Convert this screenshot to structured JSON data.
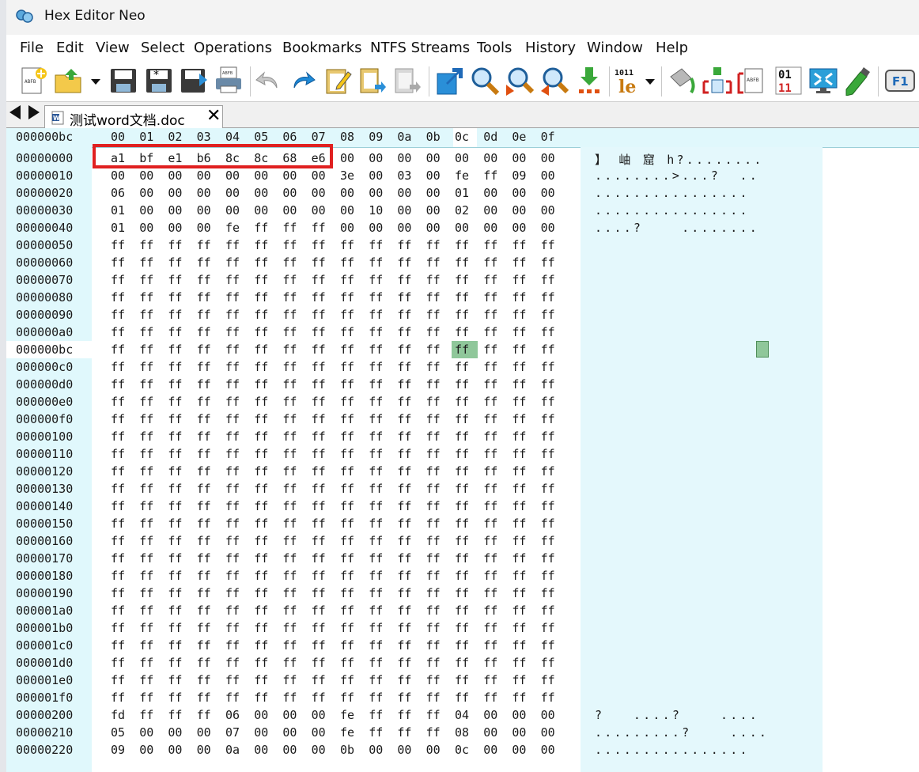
{
  "window": {
    "title": "Hex Editor Neo"
  },
  "menu": [
    "File",
    "Edit",
    "View",
    "Select",
    "Operations",
    "Bookmarks",
    "NTFS Streams",
    "Tools",
    "History",
    "Window",
    "Help"
  ],
  "toolbar_icons": [
    "new-file-icon",
    "open-file-icon",
    "dropdown-arrow-icon",
    "save-icon",
    "save-modified-icon",
    "save-all-icon",
    "print-icon",
    "undo-icon",
    "redo-icon",
    "paste-icon",
    "copy-icon",
    "cut-icon",
    "export-icon",
    "find-icon",
    "find-next-icon",
    "find-prev-icon",
    "goto-icon",
    "pattern-icon",
    "hex-format-icon",
    "fill-icon",
    "compare-icon",
    "insert-icon",
    "binary-icon",
    "fullscreen-icon",
    "highlighter-icon",
    "help-icon"
  ],
  "tab": {
    "label": "测试word文档.doc",
    "close": "✕"
  },
  "hex": {
    "current_offset": "000000bc",
    "column_headers": [
      "00",
      "01",
      "02",
      "03",
      "04",
      "05",
      "06",
      "07",
      "08",
      "09",
      "0a",
      "0b",
      "0c",
      "0d",
      "0e",
      "0f"
    ],
    "rows": [
      {
        "offset": "00000000",
        "bytes": [
          "a1",
          "bf",
          "e1",
          "b6",
          "8c",
          "8c",
          "68",
          "e6",
          "00",
          "00",
          "00",
          "00",
          "00",
          "00",
          "00",
          "00"
        ],
        "ascii": "】 岫 窟 h?........"
      },
      {
        "offset": "00000010",
        "bytes": [
          "00",
          "00",
          "00",
          "00",
          "00",
          "00",
          "00",
          "00",
          "3e",
          "00",
          "03",
          "00",
          "fe",
          "ff",
          "09",
          "00"
        ],
        "ascii": "........>...?  .."
      },
      {
        "offset": "00000020",
        "bytes": [
          "06",
          "00",
          "00",
          "00",
          "00",
          "00",
          "00",
          "00",
          "00",
          "00",
          "00",
          "00",
          "01",
          "00",
          "00",
          "00"
        ],
        "ascii": "................"
      },
      {
        "offset": "00000030",
        "bytes": [
          "01",
          "00",
          "00",
          "00",
          "00",
          "00",
          "00",
          "00",
          "00",
          "10",
          "00",
          "00",
          "02",
          "00",
          "00",
          "00"
        ],
        "ascii": "................"
      },
      {
        "offset": "00000040",
        "bytes": [
          "01",
          "00",
          "00",
          "00",
          "fe",
          "ff",
          "ff",
          "ff",
          "00",
          "00",
          "00",
          "00",
          "00",
          "00",
          "00",
          "00"
        ],
        "ascii": "....?    ........"
      },
      {
        "offset": "00000050",
        "bytes": [
          "ff",
          "ff",
          "ff",
          "ff",
          "ff",
          "ff",
          "ff",
          "ff",
          "ff",
          "ff",
          "ff",
          "ff",
          "ff",
          "ff",
          "ff",
          "ff"
        ],
        "ascii": ""
      },
      {
        "offset": "00000060",
        "bytes": [
          "ff",
          "ff",
          "ff",
          "ff",
          "ff",
          "ff",
          "ff",
          "ff",
          "ff",
          "ff",
          "ff",
          "ff",
          "ff",
          "ff",
          "ff",
          "ff"
        ],
        "ascii": ""
      },
      {
        "offset": "00000070",
        "bytes": [
          "ff",
          "ff",
          "ff",
          "ff",
          "ff",
          "ff",
          "ff",
          "ff",
          "ff",
          "ff",
          "ff",
          "ff",
          "ff",
          "ff",
          "ff",
          "ff"
        ],
        "ascii": ""
      },
      {
        "offset": "00000080",
        "bytes": [
          "ff",
          "ff",
          "ff",
          "ff",
          "ff",
          "ff",
          "ff",
          "ff",
          "ff",
          "ff",
          "ff",
          "ff",
          "ff",
          "ff",
          "ff",
          "ff"
        ],
        "ascii": ""
      },
      {
        "offset": "00000090",
        "bytes": [
          "ff",
          "ff",
          "ff",
          "ff",
          "ff",
          "ff",
          "ff",
          "ff",
          "ff",
          "ff",
          "ff",
          "ff",
          "ff",
          "ff",
          "ff",
          "ff"
        ],
        "ascii": ""
      },
      {
        "offset": "000000a0",
        "bytes": [
          "ff",
          "ff",
          "ff",
          "ff",
          "ff",
          "ff",
          "ff",
          "ff",
          "ff",
          "ff",
          "ff",
          "ff",
          "ff",
          "ff",
          "ff",
          "ff"
        ],
        "ascii": ""
      },
      {
        "offset": "000000bc",
        "bytes": [
          "ff",
          "ff",
          "ff",
          "ff",
          "ff",
          "ff",
          "ff",
          "ff",
          "ff",
          "ff",
          "ff",
          "ff",
          "ff",
          "ff",
          "ff",
          "ff"
        ],
        "ascii": ""
      },
      {
        "offset": "000000c0",
        "bytes": [
          "ff",
          "ff",
          "ff",
          "ff",
          "ff",
          "ff",
          "ff",
          "ff",
          "ff",
          "ff",
          "ff",
          "ff",
          "ff",
          "ff",
          "ff",
          "ff"
        ],
        "ascii": ""
      },
      {
        "offset": "000000d0",
        "bytes": [
          "ff",
          "ff",
          "ff",
          "ff",
          "ff",
          "ff",
          "ff",
          "ff",
          "ff",
          "ff",
          "ff",
          "ff",
          "ff",
          "ff",
          "ff",
          "ff"
        ],
        "ascii": ""
      },
      {
        "offset": "000000e0",
        "bytes": [
          "ff",
          "ff",
          "ff",
          "ff",
          "ff",
          "ff",
          "ff",
          "ff",
          "ff",
          "ff",
          "ff",
          "ff",
          "ff",
          "ff",
          "ff",
          "ff"
        ],
        "ascii": ""
      },
      {
        "offset": "000000f0",
        "bytes": [
          "ff",
          "ff",
          "ff",
          "ff",
          "ff",
          "ff",
          "ff",
          "ff",
          "ff",
          "ff",
          "ff",
          "ff",
          "ff",
          "ff",
          "ff",
          "ff"
        ],
        "ascii": ""
      },
      {
        "offset": "00000100",
        "bytes": [
          "ff",
          "ff",
          "ff",
          "ff",
          "ff",
          "ff",
          "ff",
          "ff",
          "ff",
          "ff",
          "ff",
          "ff",
          "ff",
          "ff",
          "ff",
          "ff"
        ],
        "ascii": ""
      },
      {
        "offset": "00000110",
        "bytes": [
          "ff",
          "ff",
          "ff",
          "ff",
          "ff",
          "ff",
          "ff",
          "ff",
          "ff",
          "ff",
          "ff",
          "ff",
          "ff",
          "ff",
          "ff",
          "ff"
        ],
        "ascii": ""
      },
      {
        "offset": "00000120",
        "bytes": [
          "ff",
          "ff",
          "ff",
          "ff",
          "ff",
          "ff",
          "ff",
          "ff",
          "ff",
          "ff",
          "ff",
          "ff",
          "ff",
          "ff",
          "ff",
          "ff"
        ],
        "ascii": ""
      },
      {
        "offset": "00000130",
        "bytes": [
          "ff",
          "ff",
          "ff",
          "ff",
          "ff",
          "ff",
          "ff",
          "ff",
          "ff",
          "ff",
          "ff",
          "ff",
          "ff",
          "ff",
          "ff",
          "ff"
        ],
        "ascii": ""
      },
      {
        "offset": "00000140",
        "bytes": [
          "ff",
          "ff",
          "ff",
          "ff",
          "ff",
          "ff",
          "ff",
          "ff",
          "ff",
          "ff",
          "ff",
          "ff",
          "ff",
          "ff",
          "ff",
          "ff"
        ],
        "ascii": ""
      },
      {
        "offset": "00000150",
        "bytes": [
          "ff",
          "ff",
          "ff",
          "ff",
          "ff",
          "ff",
          "ff",
          "ff",
          "ff",
          "ff",
          "ff",
          "ff",
          "ff",
          "ff",
          "ff",
          "ff"
        ],
        "ascii": ""
      },
      {
        "offset": "00000160",
        "bytes": [
          "ff",
          "ff",
          "ff",
          "ff",
          "ff",
          "ff",
          "ff",
          "ff",
          "ff",
          "ff",
          "ff",
          "ff",
          "ff",
          "ff",
          "ff",
          "ff"
        ],
        "ascii": ""
      },
      {
        "offset": "00000170",
        "bytes": [
          "ff",
          "ff",
          "ff",
          "ff",
          "ff",
          "ff",
          "ff",
          "ff",
          "ff",
          "ff",
          "ff",
          "ff",
          "ff",
          "ff",
          "ff",
          "ff"
        ],
        "ascii": ""
      },
      {
        "offset": "00000180",
        "bytes": [
          "ff",
          "ff",
          "ff",
          "ff",
          "ff",
          "ff",
          "ff",
          "ff",
          "ff",
          "ff",
          "ff",
          "ff",
          "ff",
          "ff",
          "ff",
          "ff"
        ],
        "ascii": ""
      },
      {
        "offset": "00000190",
        "bytes": [
          "ff",
          "ff",
          "ff",
          "ff",
          "ff",
          "ff",
          "ff",
          "ff",
          "ff",
          "ff",
          "ff",
          "ff",
          "ff",
          "ff",
          "ff",
          "ff"
        ],
        "ascii": ""
      },
      {
        "offset": "000001a0",
        "bytes": [
          "ff",
          "ff",
          "ff",
          "ff",
          "ff",
          "ff",
          "ff",
          "ff",
          "ff",
          "ff",
          "ff",
          "ff",
          "ff",
          "ff",
          "ff",
          "ff"
        ],
        "ascii": ""
      },
      {
        "offset": "000001b0",
        "bytes": [
          "ff",
          "ff",
          "ff",
          "ff",
          "ff",
          "ff",
          "ff",
          "ff",
          "ff",
          "ff",
          "ff",
          "ff",
          "ff",
          "ff",
          "ff",
          "ff"
        ],
        "ascii": ""
      },
      {
        "offset": "000001c0",
        "bytes": [
          "ff",
          "ff",
          "ff",
          "ff",
          "ff",
          "ff",
          "ff",
          "ff",
          "ff",
          "ff",
          "ff",
          "ff",
          "ff",
          "ff",
          "ff",
          "ff"
        ],
        "ascii": ""
      },
      {
        "offset": "000001d0",
        "bytes": [
          "ff",
          "ff",
          "ff",
          "ff",
          "ff",
          "ff",
          "ff",
          "ff",
          "ff",
          "ff",
          "ff",
          "ff",
          "ff",
          "ff",
          "ff",
          "ff"
        ],
        "ascii": ""
      },
      {
        "offset": "000001e0",
        "bytes": [
          "ff",
          "ff",
          "ff",
          "ff",
          "ff",
          "ff",
          "ff",
          "ff",
          "ff",
          "ff",
          "ff",
          "ff",
          "ff",
          "ff",
          "ff",
          "ff"
        ],
        "ascii": ""
      },
      {
        "offset": "000001f0",
        "bytes": [
          "ff",
          "ff",
          "ff",
          "ff",
          "ff",
          "ff",
          "ff",
          "ff",
          "ff",
          "ff",
          "ff",
          "ff",
          "ff",
          "ff",
          "ff",
          "ff"
        ],
        "ascii": ""
      },
      {
        "offset": "00000200",
        "bytes": [
          "fd",
          "ff",
          "ff",
          "ff",
          "06",
          "00",
          "00",
          "00",
          "fe",
          "ff",
          "ff",
          "ff",
          "04",
          "00",
          "00",
          "00"
        ],
        "ascii": "?   ....?    ...."
      },
      {
        "offset": "00000210",
        "bytes": [
          "05",
          "00",
          "00",
          "00",
          "07",
          "00",
          "00",
          "00",
          "fe",
          "ff",
          "ff",
          "ff",
          "08",
          "00",
          "00",
          "00"
        ],
        "ascii": ".........?    ...."
      },
      {
        "offset": "00000220",
        "bytes": [
          "09",
          "00",
          "00",
          "00",
          "0a",
          "00",
          "00",
          "00",
          "0b",
          "00",
          "00",
          "00",
          "0c",
          "00",
          "00",
          "00"
        ],
        "ascii": "................"
      }
    ]
  },
  "colors": {
    "highlight_box": "#e02020",
    "cursor": "#8fc79a",
    "panel": "#e0f8fc"
  }
}
